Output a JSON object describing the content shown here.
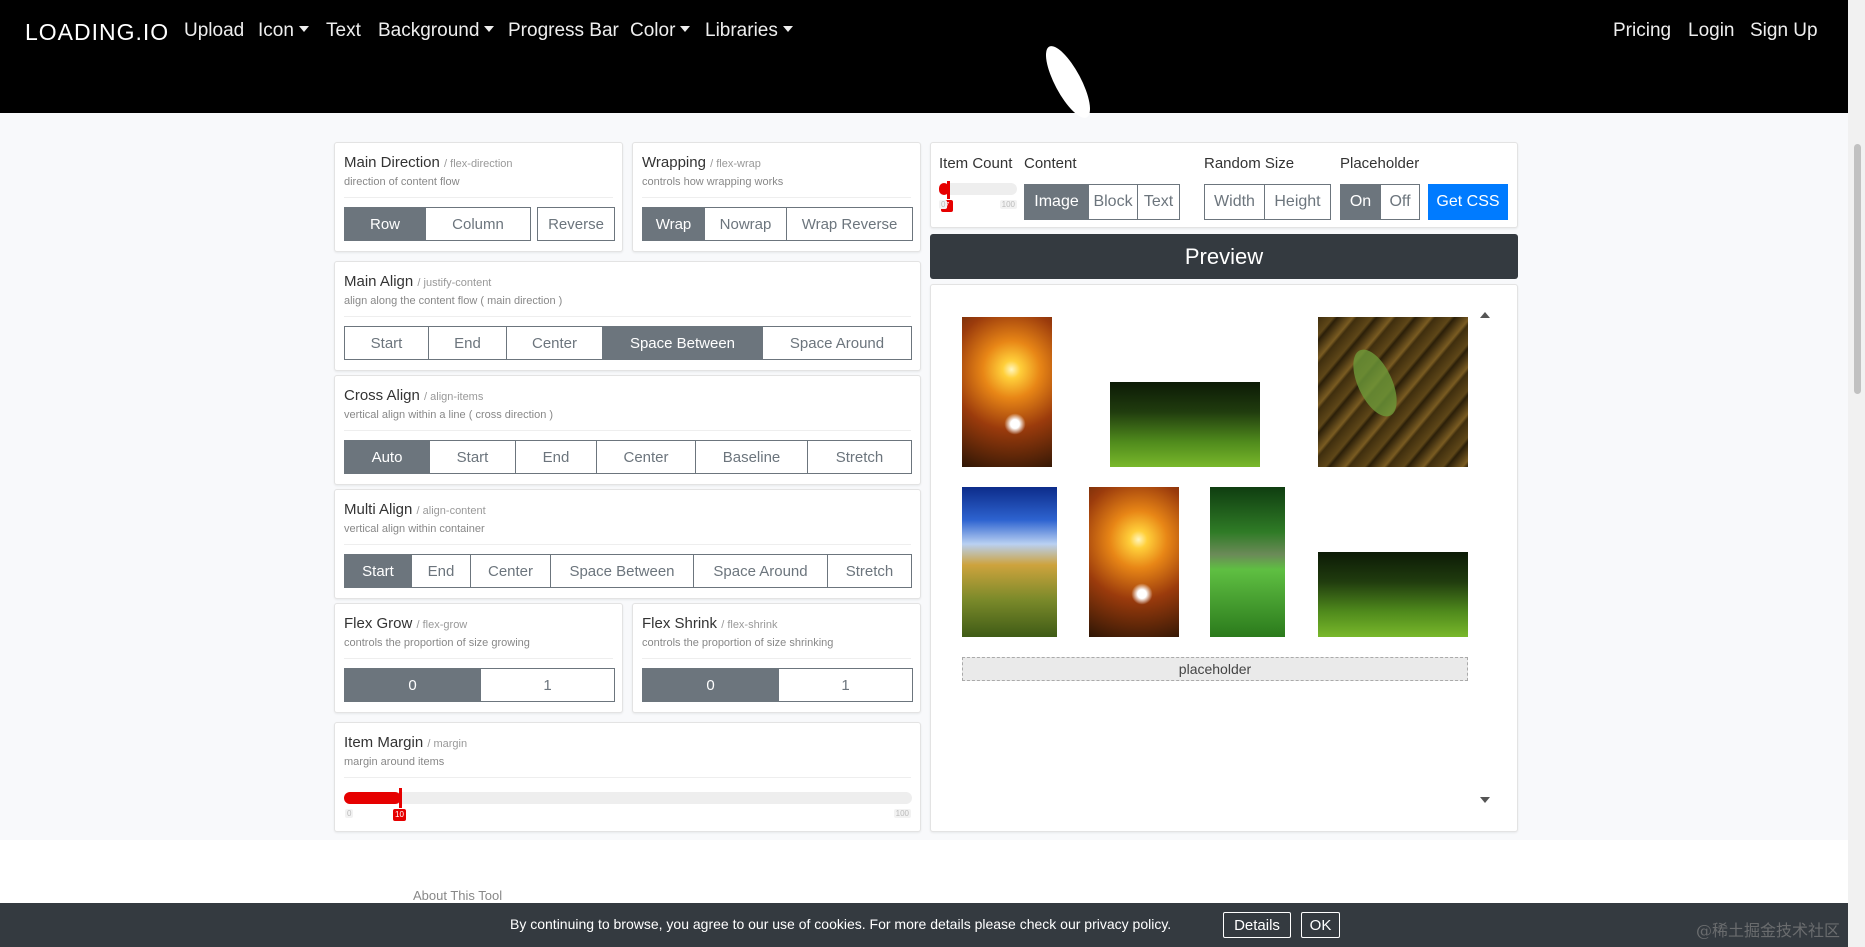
{
  "nav": {
    "brand": "LOADING.IO",
    "items": [
      {
        "label": "Upload",
        "dropdown": false
      },
      {
        "label": "Icon",
        "dropdown": true
      },
      {
        "label": "Text",
        "dropdown": false
      },
      {
        "label": "Background",
        "dropdown": true
      },
      {
        "label": "Progress Bar",
        "dropdown": false
      },
      {
        "label": "Color",
        "dropdown": true
      },
      {
        "label": "Libraries",
        "dropdown": true
      }
    ],
    "right": [
      "Pricing",
      "Login",
      "Sign Up"
    ]
  },
  "panels": {
    "direction": {
      "title": "Main Direction",
      "prop": "/ flex-direction",
      "desc": "direction of content flow",
      "options": [
        "Row",
        "Column",
        "Reverse"
      ],
      "selected": "Row"
    },
    "wrap": {
      "title": "Wrapping",
      "prop": "/ flex-wrap",
      "desc": "controls how wrapping works",
      "options": [
        "Wrap",
        "Nowrap",
        "Wrap Reverse"
      ],
      "selected": "Wrap"
    },
    "justify": {
      "title": "Main Align",
      "prop": "/ justify-content",
      "desc": "align along the content flow ( main direction )",
      "options": [
        "Start",
        "End",
        "Center",
        "Space Between",
        "Space Around"
      ],
      "selected": "Space Between"
    },
    "align_items": {
      "title": "Cross Align",
      "prop": "/ align-items",
      "desc": "vertical align within a line ( cross direction )",
      "options": [
        "Auto",
        "Start",
        "End",
        "Center",
        "Baseline",
        "Stretch"
      ],
      "selected": "Auto"
    },
    "align_content": {
      "title": "Multi Align",
      "prop": "/ align-content",
      "desc": "vertical align within container",
      "options": [
        "Start",
        "End",
        "Center",
        "Space Between",
        "Space Around",
        "Stretch"
      ],
      "selected": "Start"
    },
    "grow": {
      "title": "Flex Grow",
      "prop": "/ flex-grow",
      "desc": "controls the proportion of size growing",
      "options": [
        "0",
        "1"
      ],
      "selected": "0"
    },
    "shrink": {
      "title": "Flex Shrink",
      "prop": "/ flex-shrink",
      "desc": "controls the proportion of size shrinking",
      "options": [
        "0",
        "1"
      ],
      "selected": "0"
    },
    "margin": {
      "title": "Item Margin",
      "prop": "/ margin",
      "desc": "margin around items",
      "min": "0",
      "max": "100",
      "value": "10",
      "value_num": 10
    }
  },
  "controls": {
    "item_count": {
      "label": "Item Count",
      "min": "0",
      "max": "100",
      "value": "7",
      "value_num": 7
    },
    "content": {
      "label": "Content",
      "options": [
        "Image",
        "Block",
        "Text"
      ],
      "selected": "Image"
    },
    "random_size": {
      "label": "Random Size",
      "options": [
        "Width",
        "Height"
      ]
    },
    "placeholder": {
      "label": "Placeholder",
      "options": [
        "On",
        "Off"
      ],
      "selected": "On"
    },
    "get_css": "Get CSS"
  },
  "preview": {
    "title": "Preview",
    "placeholder_text": "placeholder",
    "images": [
      "sunset-flowers",
      "forest-path",
      "fern-wood",
      "blue-sky-meadow",
      "sunset-flowers",
      "green-lake-forest",
      "forest-path"
    ]
  },
  "footer": {
    "about": "About This Tool",
    "cookie_text": "By continuing to browse, you agree to our use of cookies. For more details please check our privacy policy.",
    "details": "Details",
    "ok": "OK",
    "watermark": "@稀土掘金技术社区"
  },
  "colors": {
    "accent": "#e60000",
    "primary": "#007bff",
    "secondary": "#6c757d",
    "dark": "#343a40"
  }
}
